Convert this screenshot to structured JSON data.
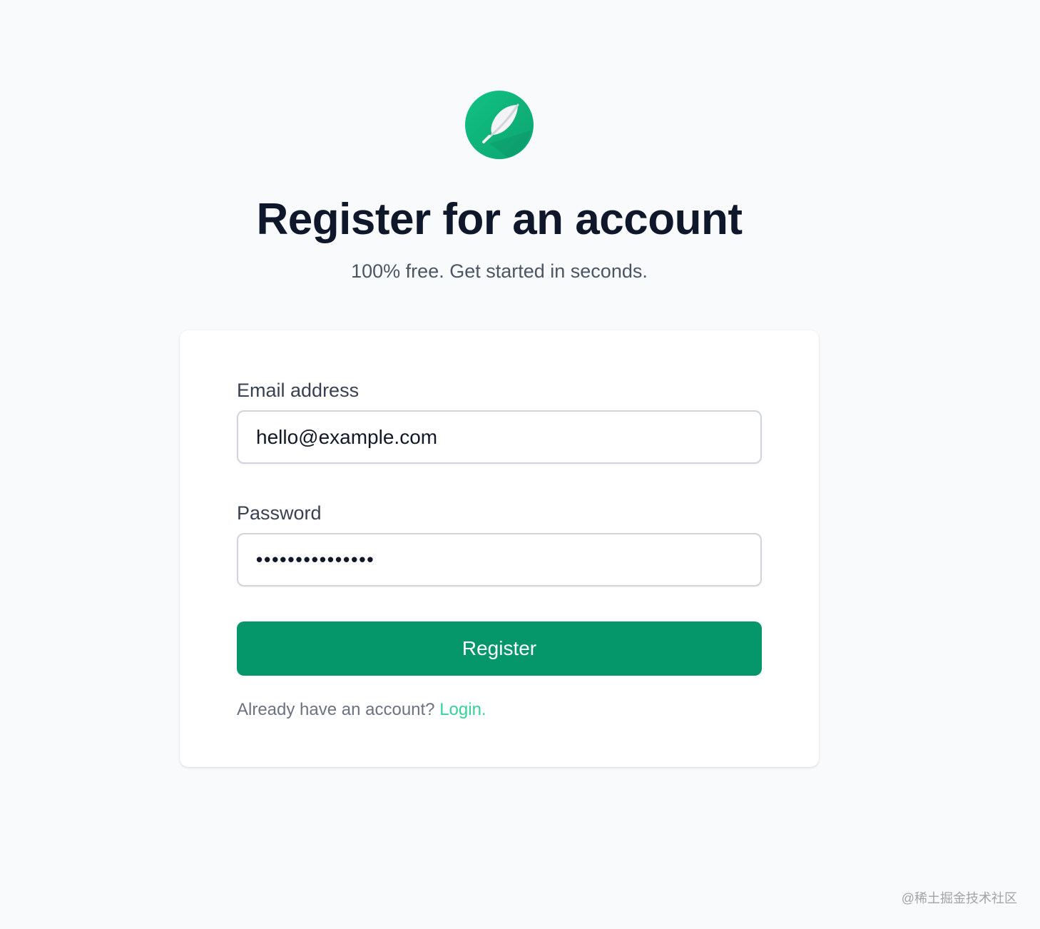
{
  "logo": {
    "icon": "feather-icon",
    "color": "#10b981"
  },
  "header": {
    "title": "Register for an account",
    "subtitle": "100% free. Get started in seconds."
  },
  "form": {
    "email_label": "Email address",
    "email_value": "hello@example.com",
    "password_label": "Password",
    "password_value": "•••••••••••••••",
    "submit_label": "Register",
    "login_prompt": "Already have an account?",
    "login_link": "Login."
  },
  "colors": {
    "background": "#f8fafc",
    "primary": "#059669",
    "link": "#34d399",
    "title": "#0f172a"
  },
  "watermark": "@稀土掘金技术社区"
}
